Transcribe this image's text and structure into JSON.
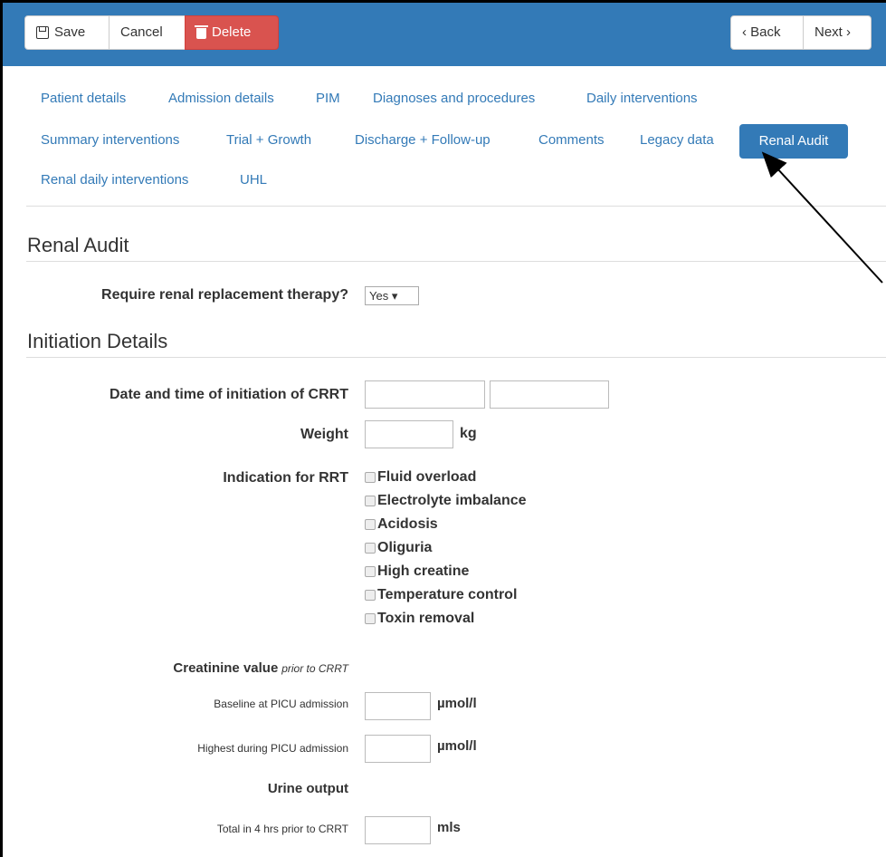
{
  "toolbar": {
    "save_label": "Save",
    "cancel_label": "Cancel",
    "delete_label": "Delete",
    "back_label": "‹ Back",
    "next_label": "Next ›"
  },
  "tabs": [
    {
      "label": "Patient details"
    },
    {
      "label": "Admission details"
    },
    {
      "label": "PIM"
    },
    {
      "label": "Diagnoses and procedures"
    },
    {
      "label": "Daily interventions"
    },
    {
      "label": "Summary interventions"
    },
    {
      "label": "Trial + Growth"
    },
    {
      "label": "Discharge + Follow-up"
    },
    {
      "label": "Comments"
    },
    {
      "label": "Legacy data"
    },
    {
      "label": "Renal Audit",
      "active": true
    },
    {
      "label": "Renal daily interventions"
    },
    {
      "label": "UHL"
    }
  ],
  "renal_audit": {
    "heading": "Renal Audit",
    "rrt_question": "Require renal replacement therapy?",
    "rrt_value": "Yes ▾"
  },
  "initiation": {
    "heading": "Initiation Details",
    "date_label": "Date and time of initiation of CRRT",
    "date_value": "",
    "time_value": "",
    "weight_label": "Weight",
    "weight_value": "",
    "weight_unit": "kg",
    "indication_label": "Indication for RRT",
    "indications": [
      "Fluid overload",
      "Electrolyte imbalance",
      "Acidosis",
      "Oliguria",
      "High creatine",
      "Temperature control",
      "Toxin removal"
    ]
  },
  "creatinine": {
    "label": "Creatinine value",
    "sublabel": "prior to CRRT",
    "baseline_label": "Baseline at PICU admission",
    "baseline_value": "",
    "baseline_unit": "µmol/l",
    "highest_label": "Highest during PICU admission",
    "highest_value": "",
    "highest_unit": "µmol/l"
  },
  "urine": {
    "label": "Urine output",
    "total_label": "Total in 4 hrs prior to CRRT",
    "total_value": "",
    "total_unit": "mls"
  },
  "colors": {
    "primary": "#337ab7",
    "danger": "#d9534f"
  }
}
